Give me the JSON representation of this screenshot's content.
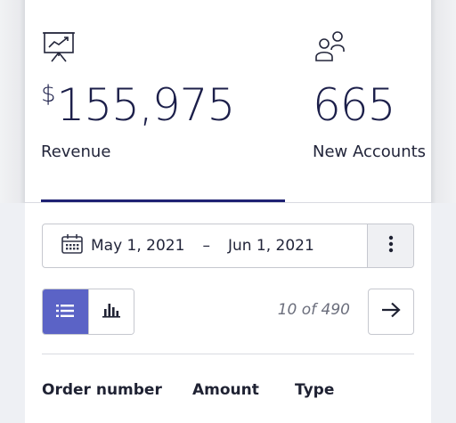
{
  "kpis": {
    "revenue": {
      "currency": "$",
      "value": "155,975",
      "label": "Revenue",
      "icon": "presentation-chart-icon"
    },
    "accounts": {
      "value": "665",
      "label": "New Accounts",
      "icon": "users-icon"
    }
  },
  "date_range": {
    "icon": "calendar-icon",
    "start": "May 1, 2021",
    "separator": "–",
    "end": "Jun 1, 2021",
    "more_icon": "more-vertical-icon"
  },
  "view_toggle": {
    "list_icon": "list-icon",
    "chart_icon": "bar-chart-icon",
    "active": "list"
  },
  "pagination": {
    "count_text": "10 of 490",
    "next_icon": "arrow-right-icon"
  },
  "table": {
    "columns": [
      "Order number",
      "Amount",
      "Type"
    ]
  },
  "colors": {
    "accent": "#5b63c6",
    "navy": "#1e2173",
    "text": "#1c1f3a"
  }
}
